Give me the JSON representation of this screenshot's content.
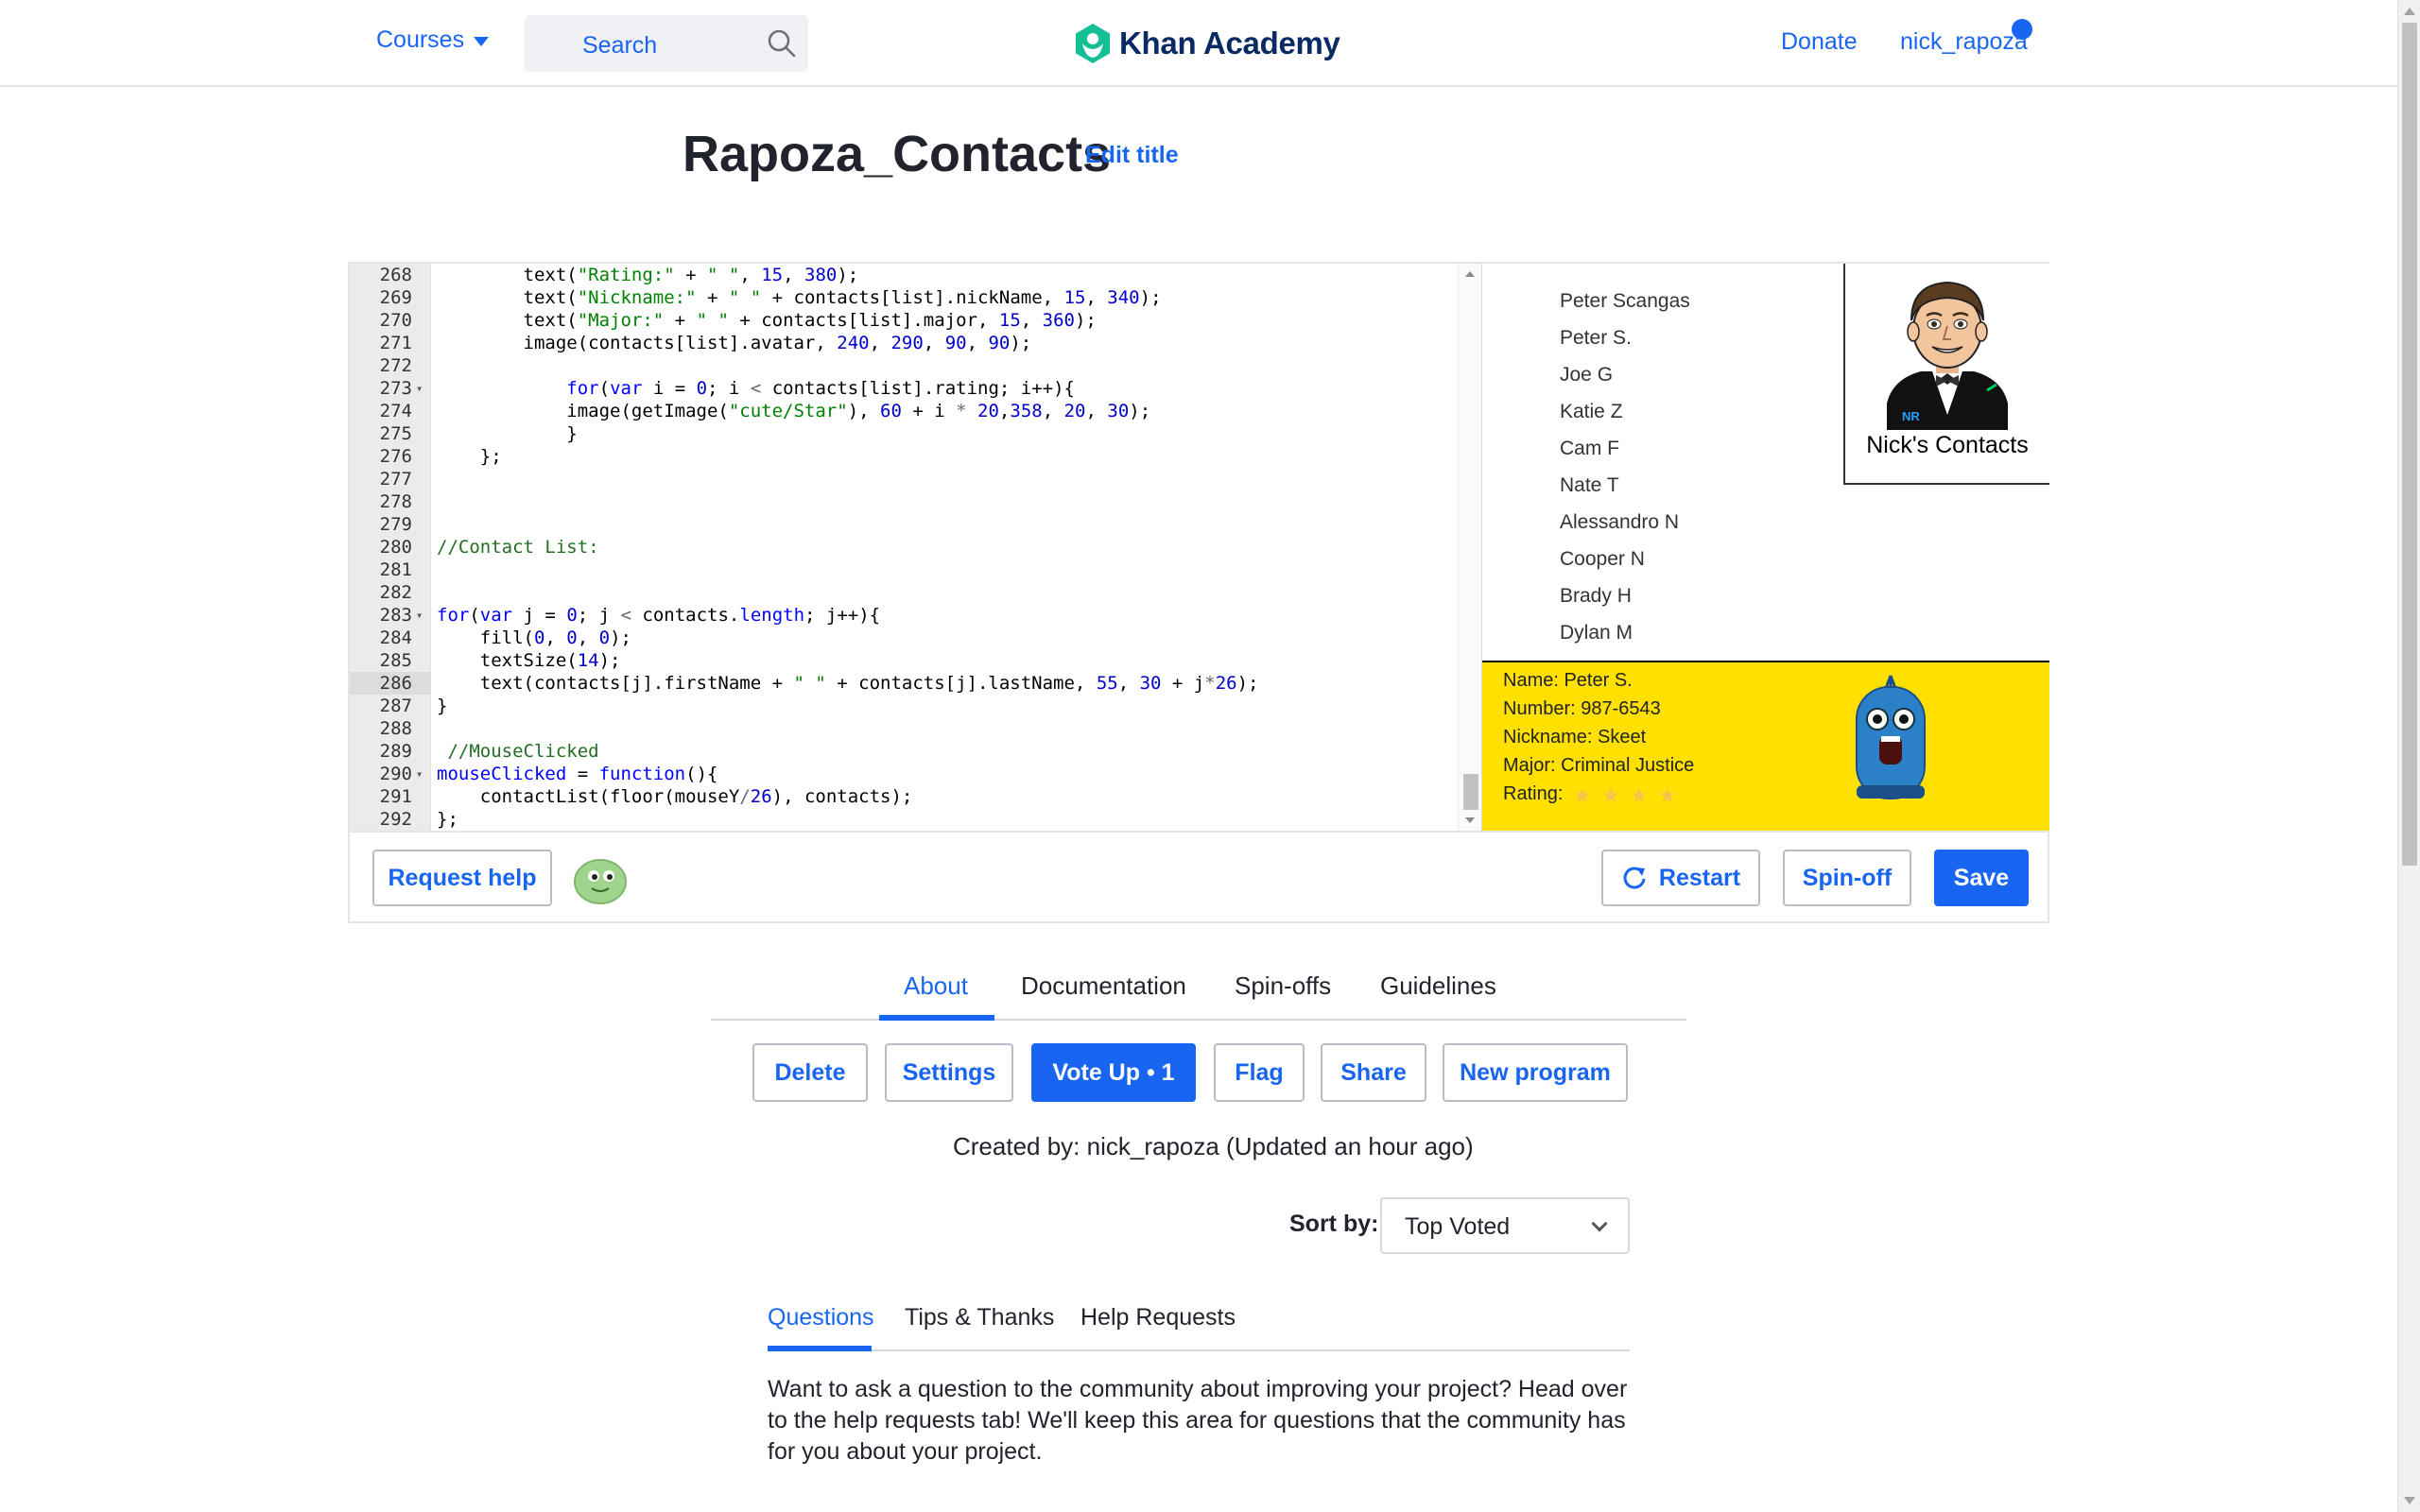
{
  "nav": {
    "courses_label": "Courses",
    "search_placeholder": "Search",
    "logo_text": "Khan Academy",
    "donate_label": "Donate",
    "username": "nick_rapoza",
    "brand_color": "#1865f2",
    "logo_color": "#14bf96"
  },
  "program": {
    "title": "Rapoza_Contacts",
    "edit_title_label": "Edit title"
  },
  "editor": {
    "lines": [
      {
        "n": "268",
        "fold": "",
        "html": "        text(<span class=\"s\">\"Rating:\"</span> + <span class=\"s\">\" \"</span>, <span class=\"n\">15</span>, <span class=\"n\">380</span>);"
      },
      {
        "n": "269",
        "fold": "",
        "html": "        text(<span class=\"s\">\"Nickname:\"</span> + <span class=\"s\">\" \"</span> + contacts[list].nickName, <span class=\"n\">15</span>, <span class=\"n\">340</span>);"
      },
      {
        "n": "270",
        "fold": "",
        "html": "        text(<span class=\"s\">\"Major:\"</span> + <span class=\"s\">\" \"</span> + contacts[list].major, <span class=\"n\">15</span>, <span class=\"n\">360</span>);"
      },
      {
        "n": "271",
        "fold": "",
        "html": "        image(contacts[list].avatar, <span class=\"n\">240</span>, <span class=\"n\">290</span>, <span class=\"n\">90</span>, <span class=\"n\">90</span>);"
      },
      {
        "n": "272",
        "fold": "",
        "html": ""
      },
      {
        "n": "273",
        "fold": "▾",
        "html": "            <span class=\"k\">for</span>(<span class=\"k\">var</span> i = <span class=\"n\">0</span>; i <span class=\"p\">&lt;</span> contacts[list].rating; i++){"
      },
      {
        "n": "274",
        "fold": "",
        "html": "            image(getImage(<span class=\"s\">\"cute/Star\"</span>), <span class=\"n\">60</span> + i <span class=\"p\">*</span> <span class=\"n\">20</span>,<span class=\"n\">358</span>, <span class=\"n\">20</span>, <span class=\"n\">30</span>);"
      },
      {
        "n": "275",
        "fold": "",
        "html": "            }"
      },
      {
        "n": "276",
        "fold": "",
        "html": "    };"
      },
      {
        "n": "277",
        "fold": "",
        "html": ""
      },
      {
        "n": "278",
        "fold": "",
        "html": ""
      },
      {
        "n": "279",
        "fold": "",
        "html": ""
      },
      {
        "n": "280",
        "fold": "",
        "html": "<span class=\"c\">//Contact List:</span>"
      },
      {
        "n": "281",
        "fold": "",
        "html": ""
      },
      {
        "n": "282",
        "fold": "",
        "html": ""
      },
      {
        "n": "283",
        "fold": "▾",
        "html": "<span class=\"k\">for</span>(<span class=\"k\">var</span> j = <span class=\"n\">0</span>; j <span class=\"p\">&lt;</span> contacts.<span class=\"k\">length</span>; j++){"
      },
      {
        "n": "284",
        "fold": "",
        "html": "    fill(<span class=\"n\">0</span>, <span class=\"n\">0</span>, <span class=\"n\">0</span>);"
      },
      {
        "n": "285",
        "fold": "",
        "html": "    textSize(<span class=\"n\">14</span>);"
      },
      {
        "n": "286",
        "fold": "",
        "html": "    text(contacts[j].firstName + <span class=\"s\">\" \"</span> + contacts[j].lastName, <span class=\"n\">55</span>, <span class=\"n\">30</span> + j<span class=\"p\">*</span><span class=\"n\">26</span>);"
      },
      {
        "n": "287",
        "fold": "",
        "html": "}"
      },
      {
        "n": "288",
        "fold": "",
        "html": ""
      },
      {
        "n": "289",
        "fold": "",
        "html": " <span class=\"c\">//MouseClicked</span>"
      },
      {
        "n": "290",
        "fold": "▾",
        "html": "<span class=\"k\">mouseClicked</span> = <span class=\"k\">function</span>(){"
      },
      {
        "n": "291",
        "fold": "",
        "html": "    contactList(floor(mouseY<span class=\"p\">/</span><span class=\"n\">26</span>), contacts);"
      },
      {
        "n": "292",
        "fold": "",
        "html": "};"
      }
    ]
  },
  "output": {
    "contacts": [
      "Peter Scangas",
      "Peter S.",
      "Joe G",
      "Katie Z",
      "Cam F",
      "Nate T",
      "Alessandro N",
      "Cooper N",
      "Brady H",
      "Dylan M"
    ],
    "logo_caption": "Nick's Contacts",
    "detail": {
      "name": "Name: Peter S.",
      "number": "Number: 987-6543",
      "nickname": "Nickname: Skeet",
      "major": "Major: Criminal Justice",
      "rating": "Rating:",
      "rating_stars": 4
    },
    "panel_color": "#ffe000"
  },
  "toolbar": {
    "request_help": "Request help",
    "restart": "Restart",
    "spinoff": "Spin-off",
    "save": "Save"
  },
  "tabs": [
    "About",
    "Documentation",
    "Spin-offs",
    "Guidelines"
  ],
  "actions": {
    "delete": "Delete",
    "settings": "Settings",
    "vote_up": "Vote Up • 1",
    "flag": "Flag",
    "share": "Share",
    "new_program": "New program"
  },
  "created_by": "Created by: nick_rapoza (Updated an hour ago)",
  "sort": {
    "label": "Sort by:",
    "value": "Top Voted"
  },
  "subtabs": [
    "Questions",
    "Tips & Thanks",
    "Help Requests"
  ],
  "help_text": "Want to ask a question to the community about improving your project? Head over to the help requests tab! We'll keep this area for questions that the community has for you about your project."
}
